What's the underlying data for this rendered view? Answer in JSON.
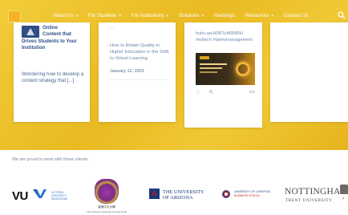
{
  "nav": {
    "items": [
      {
        "label": "About Us",
        "has_dropdown": true
      },
      {
        "label": "For Students",
        "has_dropdown": true
      },
      {
        "label": "For Institutions",
        "has_dropdown": true
      },
      {
        "label": "Solutions",
        "has_dropdown": true
      },
      {
        "label": "Rankings",
        "has_dropdown": false
      },
      {
        "label": "Resources",
        "has_dropdown": true
      },
      {
        "label": "Contact Us",
        "has_dropdown": false
      }
    ],
    "logo_color": "#f3b322",
    "search_icon": "search-icon"
  },
  "cards": {
    "card1": {
      "title_lines": [
        "Online",
        "Content that",
        "Drives Students to Your",
        "Institution"
      ],
      "excerpt": "Wondering how to develop a content strategy that [...]"
    },
    "card2": {
      "top_text": "...",
      "link": "How to Retain Quality in Higher Education in the Shift to Virtual Learning",
      "date": "January 12, 2021"
    },
    "card3": {
      "text": "hubs.ae/H0RTyM9MRH #edtech #talentmanagement",
      "likes_count": "1m",
      "actions": [
        "heart-icon",
        "share-icon"
      ]
    }
  },
  "clients": {
    "heading": "We are proud to work with these clients:",
    "logos": {
      "vu": {
        "wordmark": "VU",
        "tagline": "VICTORIA UNIVERSITY MELBOURNE"
      },
      "cuhk": {
        "cn": "香港中文大學",
        "en": "The Chinese University of Hong Kong"
      },
      "arizona": {
        "line1": "THE UNIVERSITY",
        "line2": "OF ARIZONA",
        "mark": "A"
      },
      "bu": {
        "line1": "UNIVERSITY OF LIVERPOOL",
        "line2": "BUSINESS SCHOOL"
      },
      "ntu": {
        "line1": "NOTTINGHAM",
        "line2": "TRENT UNIVERSITY"
      }
    }
  },
  "colors": {
    "background_yellow": "#edc12e",
    "card_white": "#ffffff",
    "title_blue": "#2d4f8b",
    "link_blue": "#6d88b0"
  }
}
